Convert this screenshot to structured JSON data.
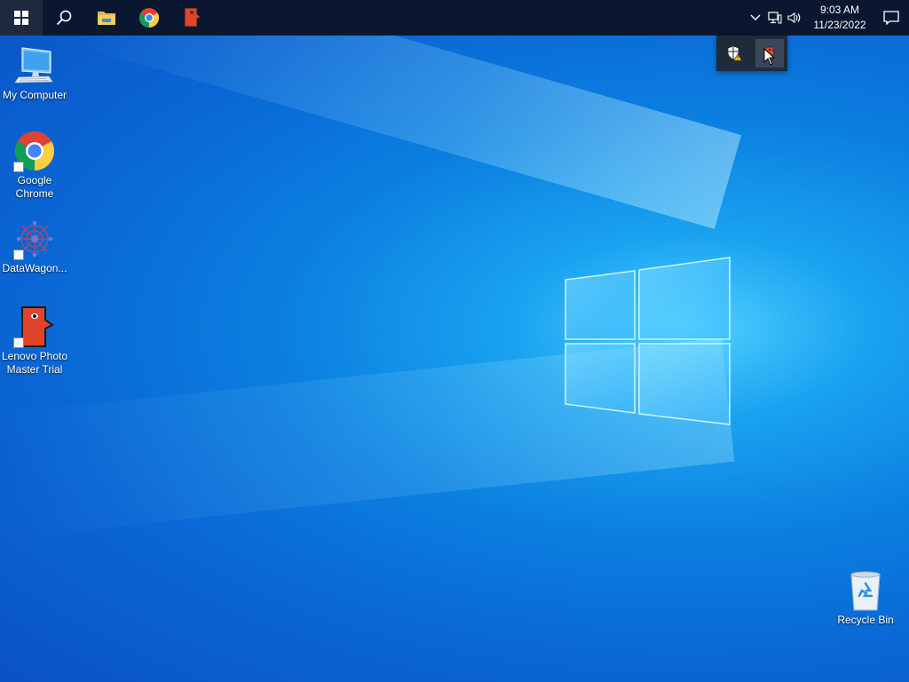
{
  "taskbar": {
    "pinned": [
      {
        "name": "start-button",
        "icon": "windows-logo-icon"
      },
      {
        "name": "search-button",
        "icon": "search-icon"
      },
      {
        "name": "file-explorer-button",
        "icon": "folder-icon"
      },
      {
        "name": "chrome-taskbar-button",
        "icon": "chrome-icon"
      },
      {
        "name": "photo-master-taskbar-button",
        "icon": "photo-master-icon"
      }
    ],
    "tray": {
      "time": "9:03 AM",
      "date": "11/23/2022"
    }
  },
  "tray_overflow": {
    "icons": [
      "security-shield-icon",
      "photo-master-tray-icon"
    ]
  },
  "desktop": {
    "icons": [
      {
        "label": "My Computer",
        "icon": "computer-icon"
      },
      {
        "label": "Google\nChrome",
        "icon": "chrome-icon"
      },
      {
        "label": "DataWagon...",
        "icon": "datawagon-icon"
      },
      {
        "label": "Lenovo Photo\nMaster Trial",
        "icon": "photo-master-icon"
      },
      {
        "label": "Recycle Bin",
        "icon": "recycle-bin-icon"
      }
    ]
  },
  "colors": {
    "taskbar": "#0b1730",
    "desktop_accent": "#0a66d4",
    "photo_master_red": "#e0442b"
  }
}
